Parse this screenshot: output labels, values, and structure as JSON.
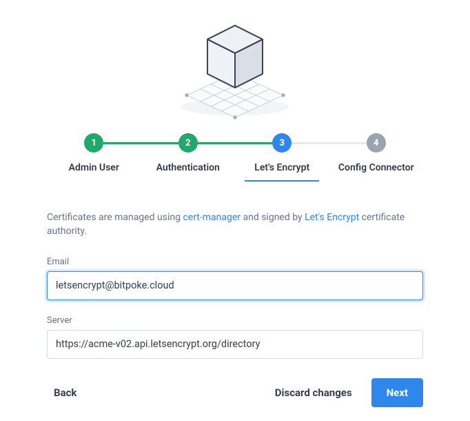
{
  "steps": [
    {
      "num": "1",
      "label": "Admin User",
      "state": "done"
    },
    {
      "num": "2",
      "label": "Authentication",
      "state": "done"
    },
    {
      "num": "3",
      "label": "Let's Encrypt",
      "state": "current"
    },
    {
      "num": "4",
      "label": "Config Connector",
      "state": "pending"
    }
  ],
  "description": {
    "pre": "Certificates are managed using ",
    "link1": "cert-manager",
    "mid": " and signed by ",
    "link2": "Let's Encrypt",
    "post": " certificate authority."
  },
  "fields": {
    "email": {
      "label": "Email",
      "value": "letsencrypt@bitpoke.cloud"
    },
    "server": {
      "label": "Server",
      "value": "https://acme-v02.api.letsencrypt.org/directory"
    }
  },
  "actions": {
    "back": "Back",
    "discard": "Discard changes",
    "next": "Next"
  }
}
